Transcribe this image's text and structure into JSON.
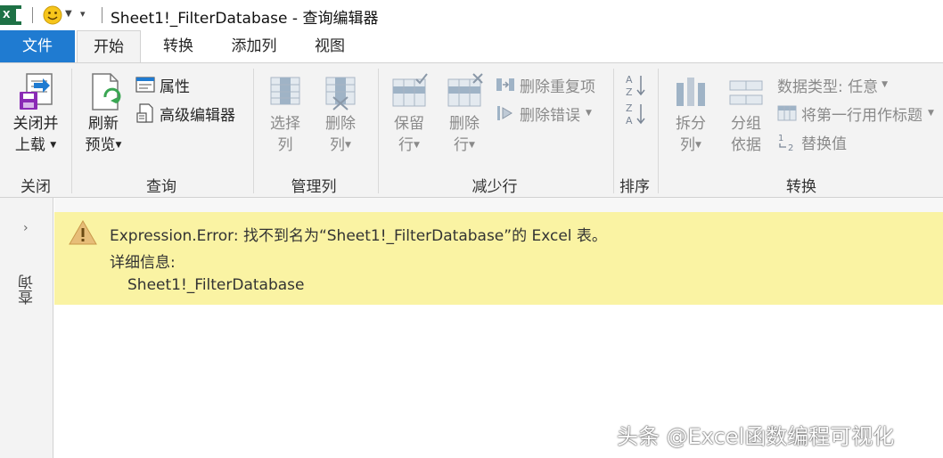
{
  "titlebar": {
    "app_icon_text": "X",
    "window_title": "Sheet1!_FilterDatabase - 查询编辑器"
  },
  "tabs": [
    {
      "label": "文件"
    },
    {
      "label": "开始"
    },
    {
      "label": "转换"
    },
    {
      "label": "添加列"
    },
    {
      "label": "视图"
    }
  ],
  "ribbon": {
    "close_group": {
      "btn_line1": "关闭并",
      "btn_line2": "上载",
      "group_label": "关闭"
    },
    "query_group": {
      "refresh_line1": "刷新",
      "refresh_line2": "预览",
      "properties": "属性",
      "advanced_editor": "高级编辑器",
      "group_label": "查询"
    },
    "manage_columns_group": {
      "choose_line1": "选择",
      "choose_line2": "列",
      "remove_line1": "删除",
      "remove_line2": "列",
      "group_label": "管理列"
    },
    "reduce_rows_group": {
      "keep_line1": "保留",
      "keep_line2": "行",
      "remove_line1": "删除",
      "remove_line2": "行",
      "remove_duplicates": "删除重复项",
      "remove_errors": "删除错误",
      "group_label": "减少行"
    },
    "sort_group": {
      "group_label": "排序"
    },
    "transform_group": {
      "split_line1": "拆分",
      "split_line2": "列",
      "group_line1": "分组",
      "group_line2": "依据",
      "data_type": "数据类型: 任意",
      "first_row_header": "将第一行用作标题",
      "replace_values": "替换值",
      "group_label": "转换"
    }
  },
  "queries_pane": {
    "label": "查询"
  },
  "error": {
    "message": "Expression.Error: 找不到名为“Sheet1!_FilterDatabase”的 Excel 表。",
    "details_label": "详细信息:",
    "details_value": "Sheet1!_FilterDatabase"
  },
  "watermark": "头条 @Excel函数编程可视化",
  "colors": {
    "file_tab": "#1f7bd1",
    "excel_green": "#1e7145",
    "error_band": "#faf3a3",
    "ribbon_bg": "#f3f3f3"
  }
}
